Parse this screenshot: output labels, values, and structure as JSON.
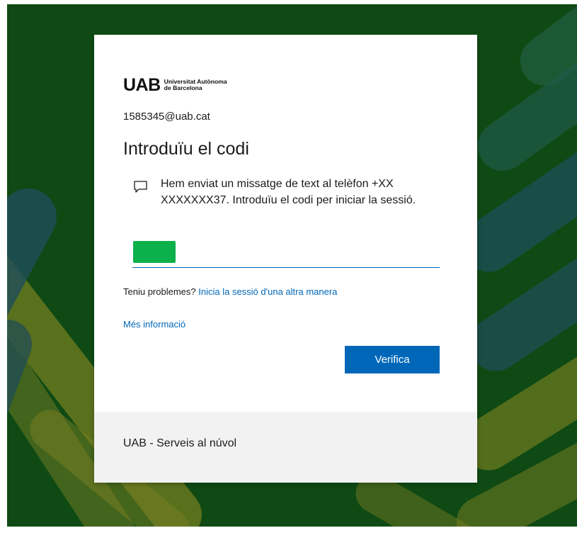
{
  "brand": {
    "logo_mark": "UAB",
    "logo_line1": "Universitat Autònoma",
    "logo_line2": "de Barcelona"
  },
  "account": {
    "email": "1585345@uab.cat"
  },
  "page": {
    "title": "Introduïu el codi",
    "message": "Hem enviat un missatge de text al telèfon +XX XXXXXXX37. Introduïu el codi per iniciar la sessió."
  },
  "code_input": {
    "value": "",
    "placeholder": ""
  },
  "help": {
    "problems_prefix": "Teniu problemes?",
    "problems_link": "Inicia la sessió d'una altra manera",
    "more_info": "Més informació"
  },
  "actions": {
    "verify_label": "Verifica"
  },
  "footer": {
    "text": "UAB - Serveis al núvol"
  },
  "colors": {
    "accent": "#0067b8",
    "background": "#0f4a14",
    "code_highlight": "#0db14b"
  },
  "icons": {
    "message": "chat-bubble-icon"
  }
}
